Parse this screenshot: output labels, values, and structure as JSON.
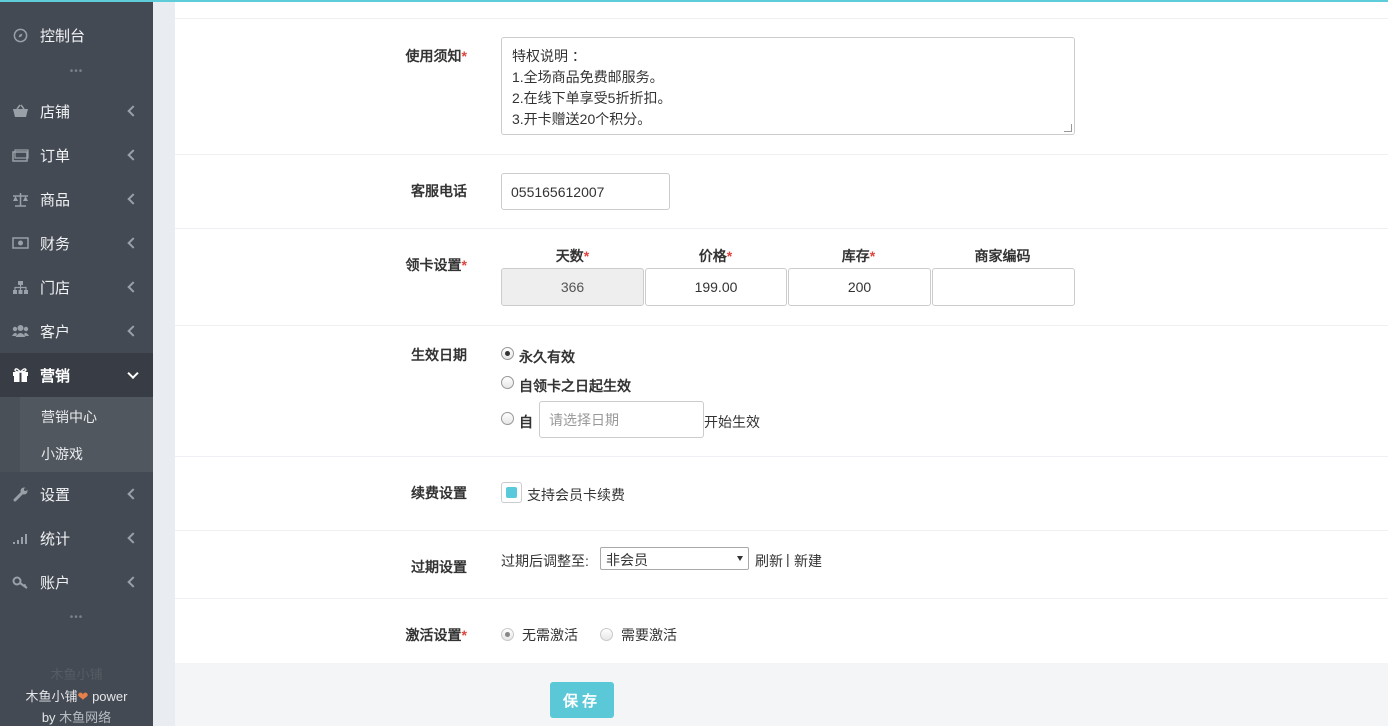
{
  "sidebar": {
    "items": [
      {
        "label": "控制台",
        "icon": "dashboard-icon"
      },
      {
        "label": "店铺",
        "icon": "basket-icon"
      },
      {
        "label": "订单",
        "icon": "money-icon"
      },
      {
        "label": "商品",
        "icon": "scale-icon"
      },
      {
        "label": "财务",
        "icon": "cash-icon"
      },
      {
        "label": "门店",
        "icon": "sitemap-icon"
      },
      {
        "label": "客户",
        "icon": "users-icon"
      },
      {
        "label": "营销",
        "icon": "gift-icon"
      },
      {
        "label": "设置",
        "icon": "wrench-icon"
      },
      {
        "label": "统计",
        "icon": "signal-icon"
      },
      {
        "label": "账户",
        "icon": "key-icon"
      }
    ],
    "dots": "•••",
    "submenu": [
      "营销中心",
      "小游戏"
    ],
    "footer_faint": "木鱼小铺",
    "footer_line1_a": "木鱼小铺",
    "footer_line1_b": "power",
    "footer_heart": "❤",
    "footer_line2_a": "by",
    "footer_line2_b": "木鱼网络"
  },
  "form": {
    "required_mark": "*",
    "notice": {
      "label": "使用须知",
      "value": "特权说明 ：\n1.全场商品免费邮服务。\n2.在线下单享受5折折扣。\n3.开卡赠送20个积分。"
    },
    "phone": {
      "label": "客服电话",
      "value": "055165612007"
    },
    "card": {
      "label": "领卡设置",
      "col_days": "天数",
      "col_price": "价格",
      "col_stock": "库存",
      "col_code": "商家编码",
      "days": "366",
      "price": "199.00",
      "stock": "200",
      "code": ""
    },
    "effective": {
      "label": "生效日期",
      "opt1": "永久有效",
      "opt2": "自领卡之日起生效",
      "opt3_prefix": "自",
      "date_placeholder": "请选择日期",
      "opt3_suffix": "开始生效"
    },
    "renew": {
      "label": "续费设置",
      "checkbox_label": "支持会员卡续费"
    },
    "expire": {
      "label": "过期设置",
      "prefix": "过期后调整至:",
      "selected": "非会员",
      "refresh": "刷新",
      "sep": "|",
      "new": "新建"
    },
    "activate": {
      "label": "激活设置",
      "opt1": "无需激活",
      "opt2": "需要激活"
    },
    "save": "保存"
  },
  "colors": {
    "accent": "#5bc8d8",
    "sidebar_bg": "#444a53",
    "required": "#e0443c"
  }
}
